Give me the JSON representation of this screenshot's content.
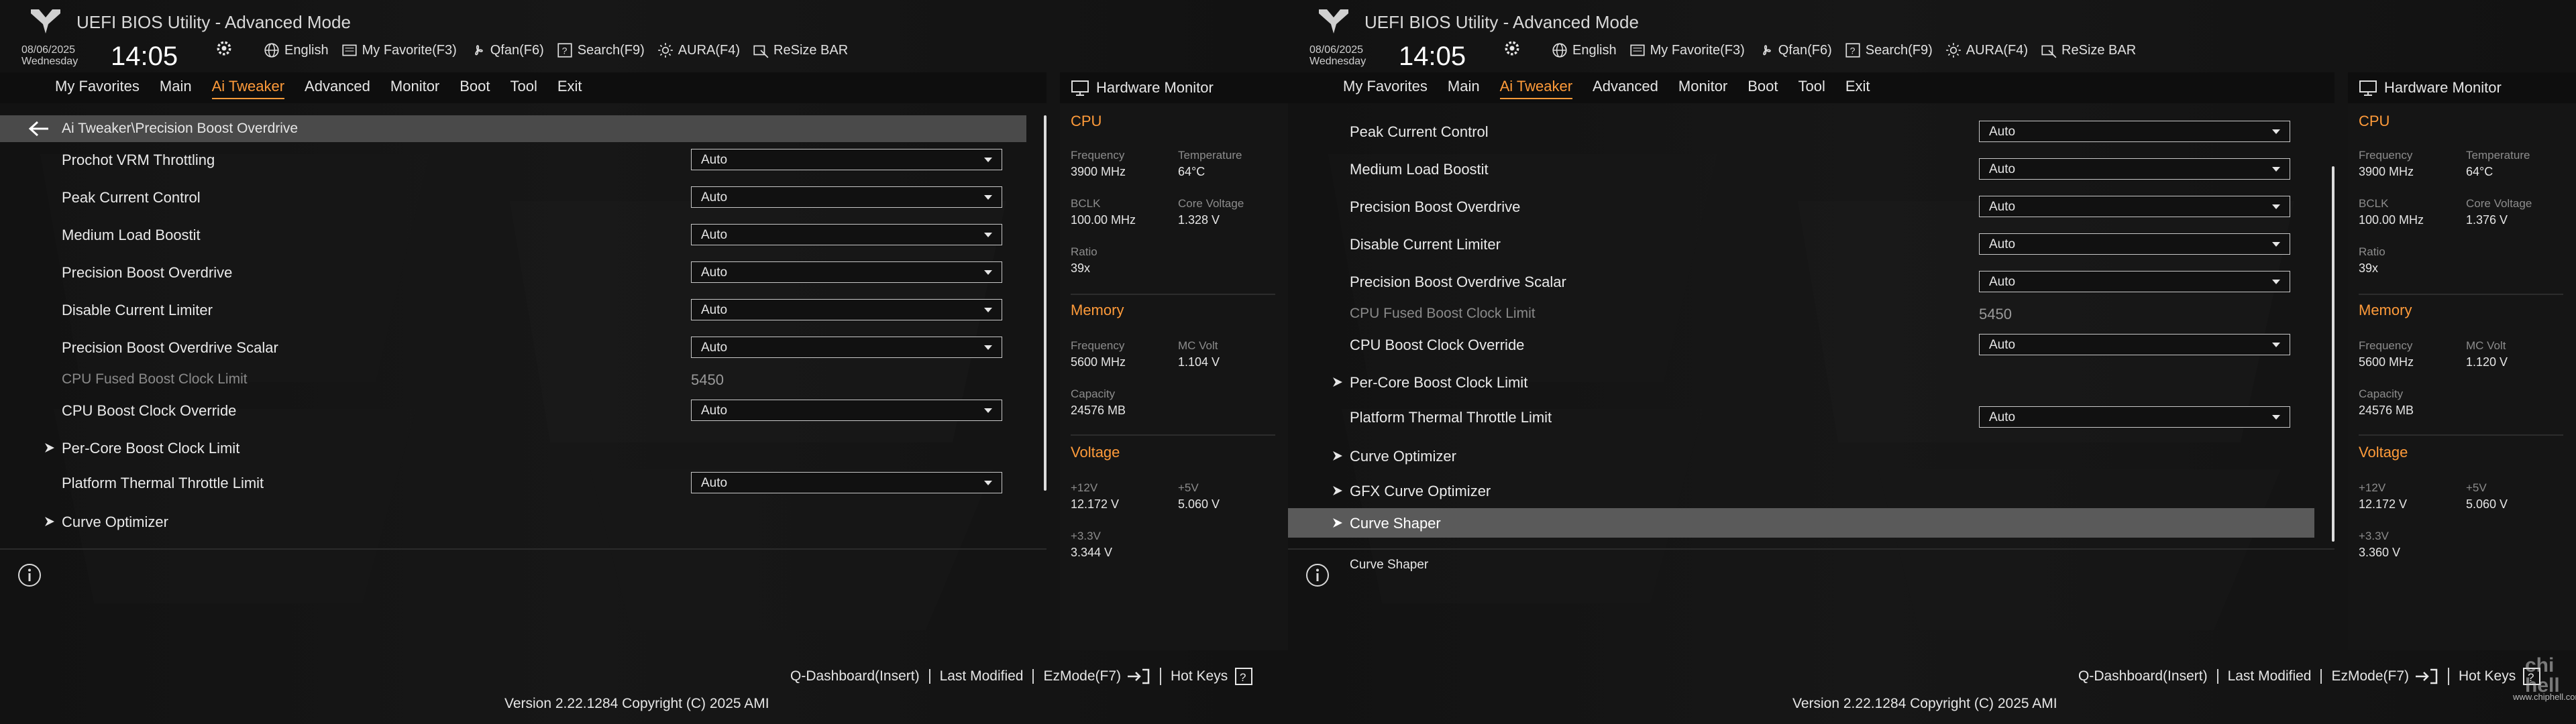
{
  "left": {
    "header": {
      "title": "UEFI BIOS Utility - Advanced Mode",
      "date": "08/06/2025",
      "day": "Wednesday",
      "time": "14:05",
      "toolbar": [
        "English",
        "My Favorite(F3)",
        "Qfan(F6)",
        "Search(F9)",
        "AURA(F4)",
        "ReSize BAR"
      ]
    },
    "menu": [
      "My Favorites",
      "Main",
      "Ai Tweaker",
      "Advanced",
      "Monitor",
      "Boot",
      "Tool",
      "Exit"
    ],
    "menu_active": "Ai Tweaker",
    "breadcrumb": "Ai Tweaker\\Precision Boost Overdrive",
    "rows": [
      {
        "label": "Prochot VRM Throttling",
        "value": "Auto"
      },
      {
        "label": "Peak Current Control",
        "value": "Auto"
      },
      {
        "label": "Medium Load Boostit",
        "value": "Auto"
      },
      {
        "label": "Precision Boost Overdrive",
        "value": "Auto"
      },
      {
        "label": "Disable Current Limiter",
        "value": "Auto"
      },
      {
        "label": "Precision Boost Overdrive Scalar",
        "value": "Auto"
      },
      {
        "label": "CPU Fused Boost Clock Limit",
        "value": "5450"
      },
      {
        "label": "CPU Boost Clock Override",
        "value": "Auto"
      },
      {
        "label": "Per-Core Boost Clock Limit"
      },
      {
        "label": "Platform Thermal Throttle Limit",
        "value": "Auto"
      },
      {
        "label": "Curve Optimizer"
      }
    ],
    "info_text": "",
    "hw": {
      "title": "Hardware Monitor",
      "cpu": {
        "label": "CPU",
        "frequency_k": "Frequency",
        "frequency": "3900 MHz",
        "temperature_k": "Temperature",
        "temperature": "64°C",
        "bclk_k": "BCLK",
        "bclk": "100.00 MHz",
        "core_voltage_k": "Core Voltage",
        "core_voltage": "1.328 V",
        "ratio_k": "Ratio",
        "ratio": "39x"
      },
      "memory": {
        "label": "Memory",
        "frequency_k": "Frequency",
        "frequency": "5600 MHz",
        "mc_volt_k": "MC Volt",
        "mc_volt": "1.104 V",
        "capacity_k": "Capacity",
        "capacity": "24576 MB"
      },
      "voltage": {
        "label": "Voltage",
        "v12_k": "+12V",
        "v12": "12.172 V",
        "v5_k": "+5V",
        "v5": "5.060 V",
        "v33_k": "+3.3V",
        "v33": "3.344 V"
      }
    },
    "footer": {
      "keys": [
        "Q-Dashboard(Insert)",
        "Last Modified",
        "EzMode(F7)",
        "Hot Keys"
      ],
      "version": "Version 2.22.1284 Copyright (C) 2025 AMI"
    }
  },
  "right": {
    "header": {
      "title": "UEFI BIOS Utility - Advanced Mode",
      "date": "08/06/2025",
      "day": "Wednesday",
      "time": "14:05",
      "toolbar": [
        "English",
        "My Favorite(F3)",
        "Qfan(F6)",
        "Search(F9)",
        "AURA(F4)",
        "ReSize BAR"
      ]
    },
    "menu": [
      "My Favorites",
      "Main",
      "Ai Tweaker",
      "Advanced",
      "Monitor",
      "Boot",
      "Tool",
      "Exit"
    ],
    "menu_active": "Ai Tweaker",
    "rows": [
      {
        "label": "Peak Current Control",
        "value": "Auto"
      },
      {
        "label": "Medium Load Boostit",
        "value": "Auto"
      },
      {
        "label": "Precision Boost Overdrive",
        "value": "Auto"
      },
      {
        "label": "Disable Current Limiter",
        "value": "Auto"
      },
      {
        "label": "Precision Boost Overdrive Scalar",
        "value": "Auto"
      },
      {
        "label": "CPU Fused Boost Clock Limit",
        "value": "5450"
      },
      {
        "label": "CPU Boost Clock Override",
        "value": "Auto"
      },
      {
        "label": "Per-Core Boost Clock Limit"
      },
      {
        "label": "Platform Thermal Throttle Limit",
        "value": "Auto"
      },
      {
        "label": "Curve Optimizer"
      },
      {
        "label": "GFX Curve Optimizer"
      },
      {
        "label": "Curve Shaper"
      }
    ],
    "selected": "Curve Shaper",
    "info_text": "Curve Shaper",
    "hw": {
      "title": "Hardware Monitor",
      "cpu": {
        "label": "CPU",
        "frequency_k": "Frequency",
        "frequency": "3900 MHz",
        "temperature_k": "Temperature",
        "temperature": "64°C",
        "bclk_k": "BCLK",
        "bclk": "100.00 MHz",
        "core_voltage_k": "Core Voltage",
        "core_voltage": "1.376 V",
        "ratio_k": "Ratio",
        "ratio": "39x"
      },
      "memory": {
        "label": "Memory",
        "frequency_k": "Frequency",
        "frequency": "5600 MHz",
        "mc_volt_k": "MC Volt",
        "mc_volt": "1.120 V",
        "capacity_k": "Capacity",
        "capacity": "24576 MB"
      },
      "voltage": {
        "label": "Voltage",
        "v12_k": "+12V",
        "v12": "12.172 V",
        "v5_k": "+5V",
        "v5": "5.060 V",
        "v33_k": "+3.3V",
        "v33": "3.360 V"
      }
    },
    "footer": {
      "keys": [
        "Q-Dashboard(Insert)",
        "Last Modified",
        "EzMode(F7)",
        "Hot Keys"
      ],
      "version": "Version 2.22.1284 Copyright (C) 2025 AMI"
    },
    "watermark": "www.chiphell.com"
  },
  "colors": {
    "accent": "#ff9b3a",
    "highlight": "#5a5a5a",
    "breadcrumb_bg": "#4a4a4a"
  }
}
